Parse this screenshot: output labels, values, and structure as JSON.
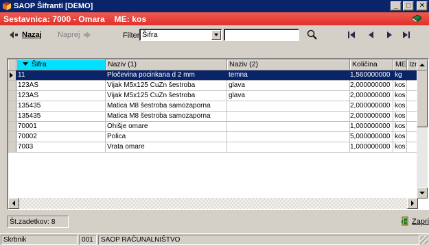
{
  "window": {
    "title": "SAOP Šifranti [DEMO]",
    "controls": {
      "minimize": "_",
      "maximize": "□",
      "close": "✕"
    }
  },
  "header": {
    "text": "Sestavnica: 7000 - Omara    ME: kos",
    "accent_color": "#e8453c"
  },
  "toolbar": {
    "back_label": "Nazaj",
    "forward_label": "Naprej",
    "filter_label": "Filter:",
    "filter_value": "Šifra",
    "search_value": "",
    "icons": [
      "search-icon",
      "first-record-icon",
      "prev-record-icon",
      "next-record-icon",
      "last-record-icon"
    ]
  },
  "grid": {
    "columns": [
      "Šifra",
      "Naziv (1)",
      "Naziv (2)",
      "Količina",
      "ME",
      "Izmet"
    ],
    "sorted_column": "Šifra",
    "rows": [
      {
        "sifra": "11",
        "naziv1": "Pločevina pocinkana d 2 mm",
        "naziv2": "temna",
        "kolicina": "1,560000000",
        "me": "kg",
        "izmet": "",
        "selected": true
      },
      {
        "sifra": "123AS",
        "naziv1": "Vijak M5x125 CuZn šestroba",
        "naziv2": "glava",
        "kolicina": "2,000000000",
        "me": "kos",
        "izmet": ""
      },
      {
        "sifra": "123AS",
        "naziv1": "Vijak M5x125 CuZn šestroba",
        "naziv2": "glava",
        "kolicina": "2,000000000",
        "me": "kos",
        "izmet": ""
      },
      {
        "sifra": "135435",
        "naziv1": "Matica M8 šestroba samozaporna",
        "naziv2": "",
        "kolicina": "2,000000000",
        "me": "kos",
        "izmet": ""
      },
      {
        "sifra": "135435",
        "naziv1": "Matica M8 šestroba samozaporna",
        "naziv2": "",
        "kolicina": "2,000000000",
        "me": "kos",
        "izmet": ""
      },
      {
        "sifra": "70001",
        "naziv1": "Ohišje omare",
        "naziv2": "",
        "kolicina": "1,000000000",
        "me": "kos",
        "izmet": ""
      },
      {
        "sifra": "70002",
        "naziv1": "Polica",
        "naziv2": "",
        "kolicina": "5,000000000",
        "me": "kos",
        "izmet": ""
      },
      {
        "sifra": "7003",
        "naziv1": "Vrata omare",
        "naziv2": "",
        "kolicina": "1,000000000",
        "me": "kos",
        "izmet": ""
      }
    ]
  },
  "footer": {
    "record_count": "Št.zadetkov: 8",
    "close_label": "Zapri"
  },
  "statusbar": {
    "user_label": "Skrbnik",
    "company_code": "001",
    "company_name": "SAOP RAČUNALNIŠTVO"
  }
}
